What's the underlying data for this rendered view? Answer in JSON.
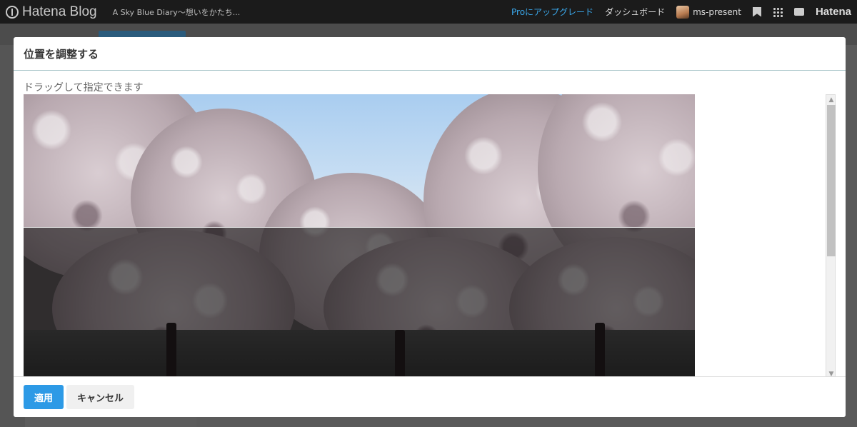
{
  "topbar": {
    "logo": "Hatena Blog",
    "blog_name": "A Sky Blue Diary～想いをかたち...",
    "pro_upgrade": "Proにアップグレード",
    "dashboard": "ダッシュボード",
    "username": "ms-present",
    "hatena": "Hatena"
  },
  "modal": {
    "title": "位置を調整する",
    "hint": "ドラッグして指定できます",
    "apply_label": "適用",
    "cancel_label": "キャンセル"
  },
  "colors": {
    "primary": "#2d9ae6",
    "topbar": "#1b1b1b",
    "pro_link": "#3aa6e8"
  },
  "icons": [
    "hatena-logo-icon",
    "bookmark-icon",
    "grid-icon",
    "chat-icon",
    "scroll-up-icon",
    "scroll-down-icon"
  ]
}
